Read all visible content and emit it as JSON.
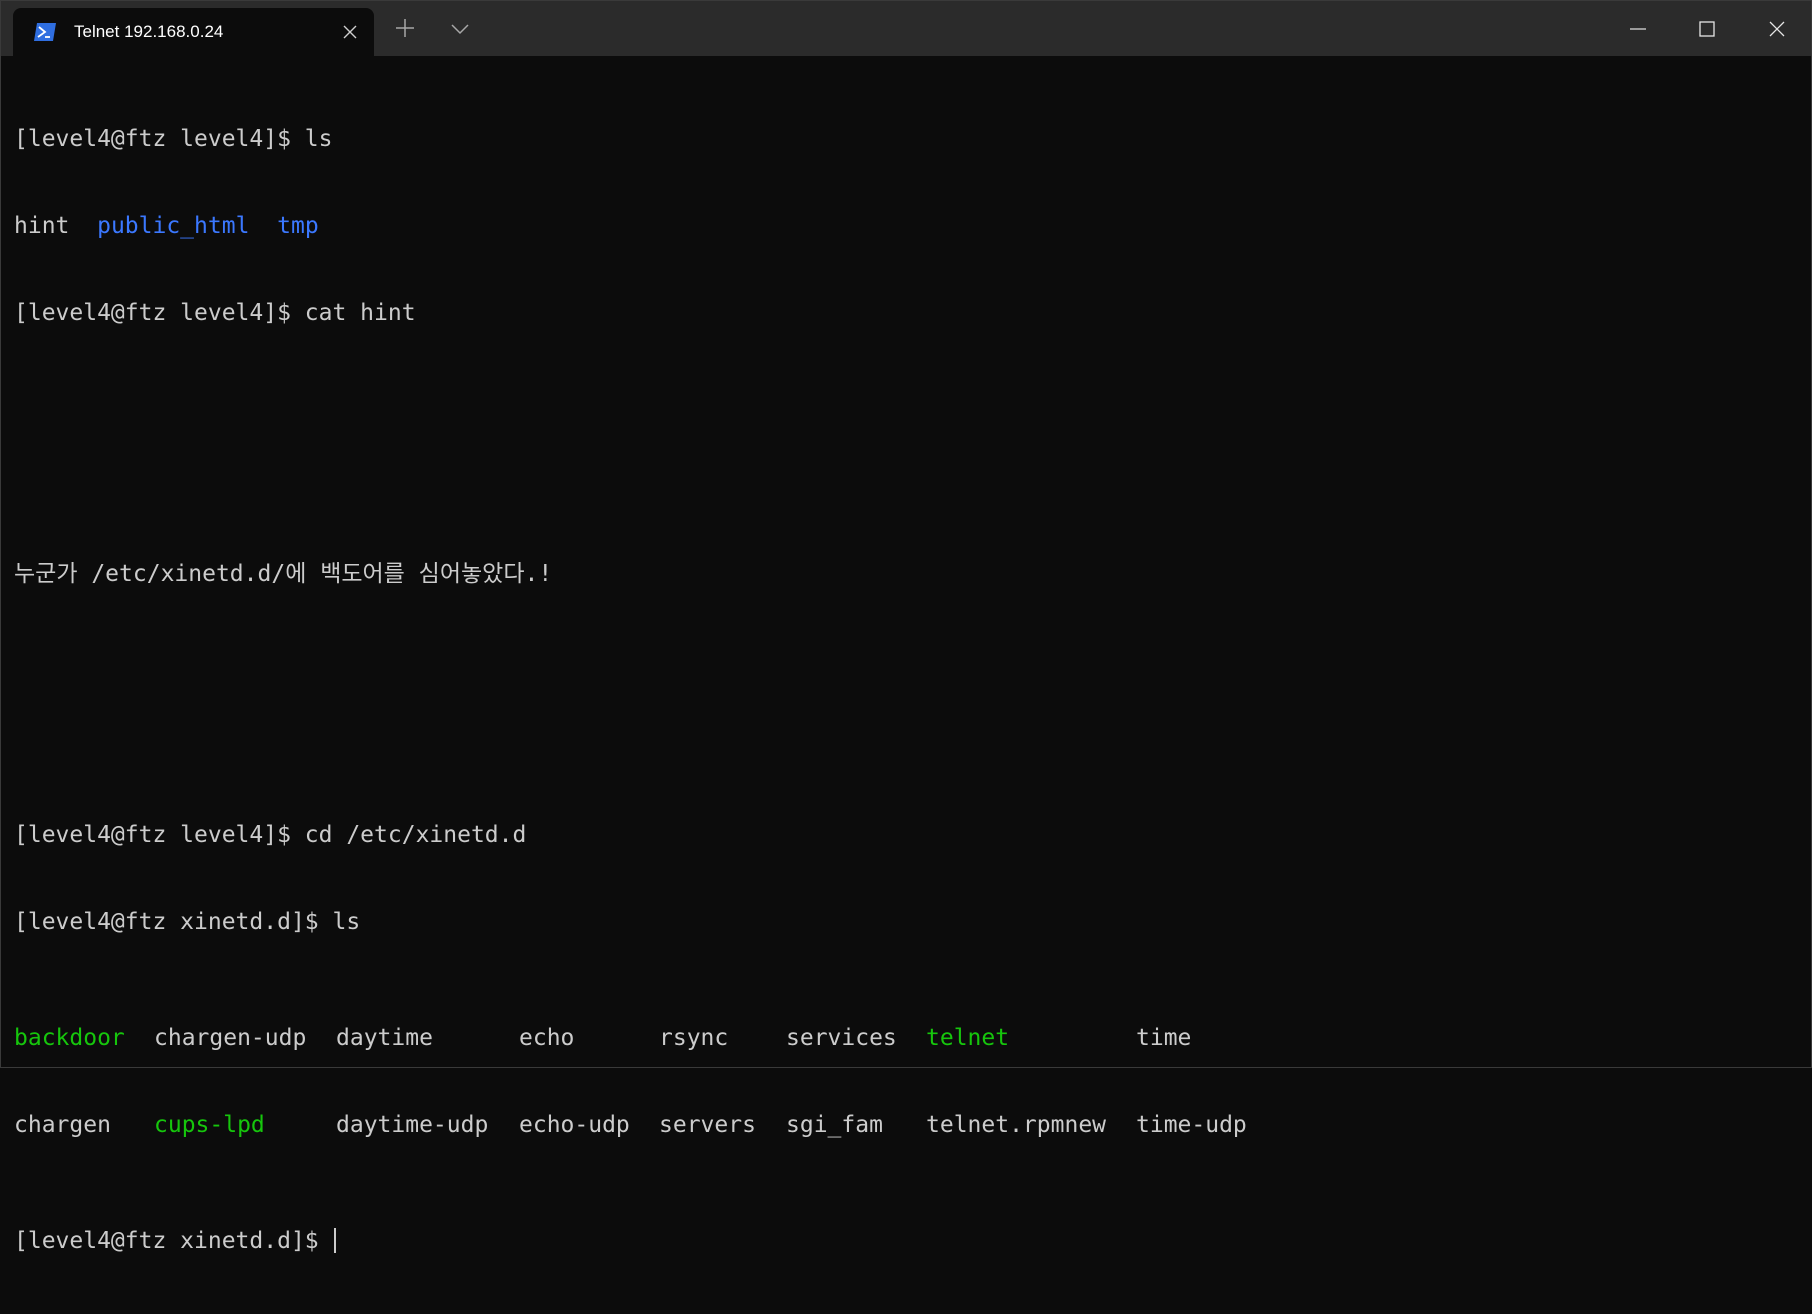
{
  "window": {
    "tab_title": "Telnet 192.168.0.24",
    "tab_icon": "powershell-icon",
    "controls": [
      "new-tab-icon",
      "dropdown-chevron-icon",
      "minimize-icon",
      "maximize-icon",
      "close-icon"
    ]
  },
  "colors": {
    "background": "#0c0c0c",
    "titlebar": "#2b2b2b",
    "text": "#cccccc",
    "directory": "#3b78ff",
    "executable": "#16c60c",
    "tab_icon": "#2f6ee0"
  },
  "terminal": {
    "line1": "[level4@ftz level4]$ ls",
    "ls1": {
      "hint": "hint",
      "public_html": "public_html",
      "tmp": "tmp"
    },
    "line3": "[level4@ftz level4]$ cat hint",
    "hint_text": "누군가 /etc/xinetd.d/에 백도어를 심어놓았다.!",
    "line_cd": "[level4@ftz level4]$ cd /etc/xinetd.d",
    "line_ls2": "[level4@ftz xinetd.d]$ ls",
    "ls2_row1": [
      "backdoor",
      "chargen-udp",
      "daytime",
      "echo",
      "rsync",
      "services",
      "telnet",
      "time"
    ],
    "ls2_row2": [
      "chargen",
      "cups-lpd",
      "daytime-udp",
      "echo-udp",
      "servers",
      "sgi_fam",
      "telnet.rpmnew",
      "time-udp"
    ],
    "prompt": "[level4@ftz xinetd.d]$ "
  }
}
